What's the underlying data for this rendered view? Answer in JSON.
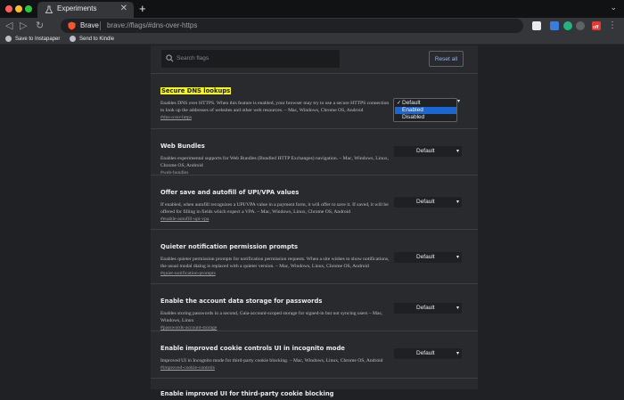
{
  "window": {
    "tab_title": "Experiments",
    "tab_close": "✕",
    "new_tab": "+",
    "menu_glyph": "⌄"
  },
  "toolbar": {
    "back_glyph": "◁",
    "forward_glyph": "▷",
    "reload_glyph": "↻",
    "brand": "Brave",
    "url": "brave://flags/#dns-over-https",
    "extension_badge": "off",
    "menu_glyph": "⋮"
  },
  "bookmarks": [
    {
      "label": "Save to Instapaper",
      "icon": "instapaper-icon"
    },
    {
      "label": "Send to Kindle",
      "icon": "kindle-icon"
    }
  ],
  "search": {
    "placeholder": "Search flags"
  },
  "reset_label": "Reset all",
  "flags": [
    {
      "title": "Secure DNS lookups",
      "description": "Enables DNS over HTTPS. When this feature is enabled, your browser may try to use a secure HTTPS connection to look up the addresses of websites and other web resources. – Mac, Windows, Chrome OS, Android",
      "link": "#dns-over-https",
      "value": "Default"
    },
    {
      "title": "Web Bundles",
      "description": "Enables experimental supports for Web Bundles (Bundled HTTP Exchanges) navigation. – Mac, Windows, Linux, Chrome OS, Android",
      "link": "#web-bundles",
      "value": "Default"
    },
    {
      "title": "Offer save and autofill of UPI/VPA values",
      "description": "If enabled, when autofill recognizes a UPI/VPA value in a payment form, it will offer to save it. If saved, it will be offered for filling in fields which expect a VPA. – Mac, Windows, Linux, Chrome OS, Android",
      "link": "#enable-autofill-upi-vpa",
      "value": "Default"
    },
    {
      "title": "Quieter notification permission prompts",
      "description": "Enables quieter permission prompts for notification permission requests. When a site wishes to show notifications, the usual modal dialog is replaced with a quieter version. – Mac, Windows, Linux, Chrome OS, Android",
      "link": "#quiet-notification-prompts",
      "value": "Default"
    },
    {
      "title": "Enable the account data storage for passwords",
      "description": "Enables storing passwords in a second, Gaia-account-scoped storage for signed-in but not syncing users – Mac, Windows, Linux",
      "link": "#passwords-account-storage",
      "value": "Default"
    },
    {
      "title": "Enable improved cookie controls UI in incognito mode",
      "description": "Improved UI in Incognito mode for third-party cookie blocking. – Mac, Windows, Linux, Chrome OS, Android",
      "link": "#improved-cookie-controls",
      "value": "Default"
    },
    {
      "title": "Enable improved UI for third-party cookie blocking",
      "description": "",
      "link": "",
      "value": ""
    }
  ],
  "dropdown_options": [
    {
      "label": "Default",
      "checked": true,
      "highlighted": false
    },
    {
      "label": "Enabled",
      "checked": false,
      "highlighted": true
    },
    {
      "label": "Disabled",
      "checked": false,
      "highlighted": false
    }
  ],
  "colors": {
    "highlight": "#f5f521",
    "selected_option": "#1a66d2",
    "link": "#8ab4f8"
  }
}
